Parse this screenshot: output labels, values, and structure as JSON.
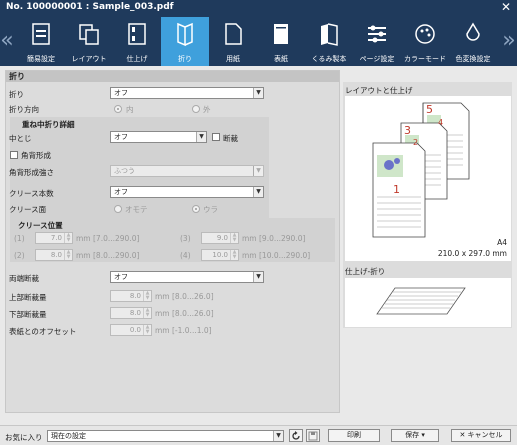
{
  "window": {
    "title": "No. 100000001 :  Sample_003.pdf",
    "close": "✕"
  },
  "toolbar": {
    "items": [
      {
        "label": "簡易設定",
        "icon": "easy-setting-icon"
      },
      {
        "label": "レイアウト",
        "icon": "layout-icon"
      },
      {
        "label": "仕上げ",
        "icon": "finishing-icon"
      },
      {
        "label": "折り",
        "icon": "fold-icon",
        "active": true
      },
      {
        "label": "用紙",
        "icon": "paper-icon"
      },
      {
        "label": "表紙",
        "icon": "cover-icon"
      },
      {
        "label": "くるみ製本",
        "icon": "perfect-binding-icon"
      },
      {
        "label": "ページ設定",
        "icon": "page-setting-icon"
      },
      {
        "label": "カラーモード",
        "icon": "color-mode-icon"
      },
      {
        "label": "色変換設定",
        "icon": "color-conversion-icon"
      }
    ],
    "prev": "«",
    "next": "»"
  },
  "fold": {
    "section": "折り",
    "fold_label": "折り",
    "fold_value": "オフ",
    "direction_label": "折り方向",
    "dir_in": "内",
    "dir_out": "外",
    "saddle_section": "重ね中折り詳細",
    "nakatoji_label": "中とじ",
    "nakatoji_value": "オフ",
    "trim_label": "断裁",
    "square_back_label": "角背形成",
    "square_strength_label": "角背形成強さ",
    "square_strength_value": "ふつう",
    "crease_count_label": "クリース本数",
    "crease_count_value": "オフ",
    "crease_side_label": "クリース面",
    "crease_front": "オモテ",
    "crease_back": "ウラ",
    "crease_pos_section": "クリース位置",
    "positions": [
      {
        "n": "(1)",
        "value": "7.0",
        "range": "mm [7.0...290.0]"
      },
      {
        "n": "(2)",
        "value": "8.0",
        "range": "mm [8.0...290.0]"
      },
      {
        "n": "(3)",
        "value": "9.0",
        "range": "mm [9.0...290.0]"
      },
      {
        "n": "(4)",
        "value": "10.0",
        "range": "mm [10.0...290.0]"
      }
    ],
    "double_trim_label": "両端断裁",
    "double_trim_value": "オフ",
    "top_trim_label": "上部断裁量",
    "top_trim_value": "8.0",
    "top_trim_range": "mm [8.0...26.0]",
    "bottom_trim_label": "下部断裁量",
    "bottom_trim_value": "8.0",
    "bottom_trim_range": "mm [8.0...26.0]",
    "cover_offset_label": "表紙とのオフセット",
    "cover_offset_value": "0.0",
    "cover_offset_range": "mm [-1.0...1.0]"
  },
  "preview": {
    "layout_title": "レイアウトと仕上げ",
    "page_numbers": [
      "5",
      "4",
      "3",
      "2",
      "1"
    ],
    "paper_size": "A4",
    "paper_dims": "210.0 x 297.0 mm",
    "fold_title": "仕上げ-折り"
  },
  "footer": {
    "favorite_label": "お気に入り",
    "favorite_value": "現在の設定",
    "print_label": "印刷",
    "save_label": "保存",
    "cancel_label": "キャンセル"
  },
  "colors": {
    "titlebar": "#1f3a5c",
    "active_tab": "#3fa0dc",
    "page_number": "#c0392b"
  }
}
